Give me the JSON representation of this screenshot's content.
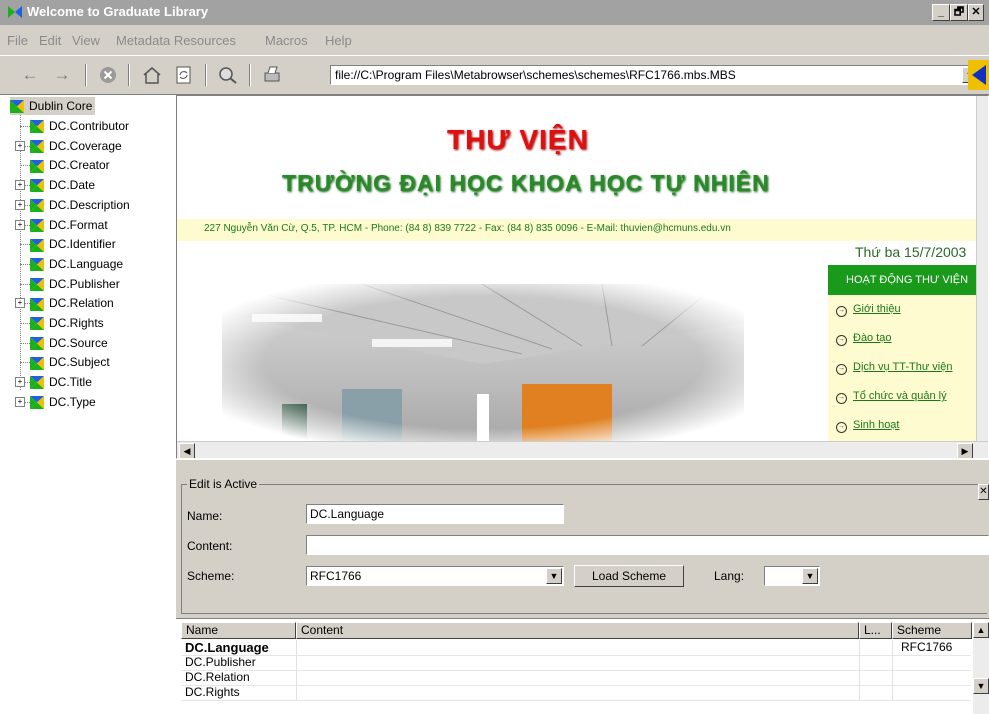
{
  "window": {
    "title": "Welcome to Graduate Library",
    "controls": [
      "_",
      "🗗",
      "✕"
    ]
  },
  "menu": [
    "File",
    "Edit",
    "View",
    "Metadata Resources",
    "Macros",
    "Help"
  ],
  "toolbar": {
    "url": "file://C:\\Program Files\\Metabrowser\\schemes\\schemes\\RFC1766.mbs.MBS",
    "icons": [
      "back-icon",
      "forward-icon",
      "stop-icon",
      "home-icon",
      "refresh-icon",
      "search-icon",
      "print-icon"
    ]
  },
  "tree": {
    "root": "Dublin Core",
    "items": [
      {
        "label": "DC.Contributor",
        "expandable": false
      },
      {
        "label": "DC.Coverage",
        "expandable": true
      },
      {
        "label": "DC.Creator",
        "expandable": false
      },
      {
        "label": "DC.Date",
        "expandable": true
      },
      {
        "label": "DC.Description",
        "expandable": true
      },
      {
        "label": "DC.Format",
        "expandable": true
      },
      {
        "label": "DC.Identifier",
        "expandable": false
      },
      {
        "label": "DC.Language",
        "expandable": false
      },
      {
        "label": "DC.Publisher",
        "expandable": false
      },
      {
        "label": "DC.Relation",
        "expandable": true
      },
      {
        "label": "DC.Rights",
        "expandable": false
      },
      {
        "label": "DC.Source",
        "expandable": false
      },
      {
        "label": "DC.Subject",
        "expandable": false
      },
      {
        "label": "DC.Title",
        "expandable": true
      },
      {
        "label": "DC.Type",
        "expandable": true
      }
    ]
  },
  "webpage": {
    "title1": "THƯ VIỆN",
    "title2": "TRƯỜNG ĐẠI HỌC KHOA HỌC TỰ NHIÊN",
    "address": "227 Nguyễn Văn Cừ, Q.5, TP. HCM - Phone: (84 8) 839 7722 - Fax: (84 8) 835 0096 -  E-Mail: thuvien@hcmuns.edu.vn",
    "date": "Thứ ba 15/7/2003",
    "nav_header": "HOẠT ĐỘNG THƯ VIỆN",
    "nav_links": [
      "Giới thiệu",
      "Đào tạo",
      "Dịch vụ TT-Thư viện",
      "Tổ chức và quản lý",
      "Sinh hoạt"
    ]
  },
  "edit": {
    "legend": "Edit is Active",
    "name_label": "Name:",
    "name_value": "DC.Language",
    "content_label": "Content:",
    "content_value": "",
    "scheme_label": "Scheme:",
    "scheme_value": "RFC1766",
    "load_button": "Load Scheme",
    "lang_label": "Lang:",
    "lang_value": ""
  },
  "table": {
    "headers": [
      "Name",
      "Content",
      "L...",
      "Scheme"
    ],
    "rows": [
      {
        "name": "DC.Language",
        "content": "",
        "l": "",
        "scheme": "RFC1766",
        "bold": true
      },
      {
        "name": "DC.Publisher",
        "content": "",
        "l": "",
        "scheme": "",
        "bold": false
      },
      {
        "name": "DC.Relation",
        "content": "",
        "l": "",
        "scheme": "",
        "bold": false
      },
      {
        "name": "DC.Rights",
        "content": "",
        "l": "",
        "scheme": "",
        "bold": false
      }
    ]
  },
  "colors": {
    "webpage_red": "#e01010",
    "webpage_green": "#2a8a2a",
    "nav_green": "#1a9a1a",
    "address_bg": "#fffbd0"
  }
}
